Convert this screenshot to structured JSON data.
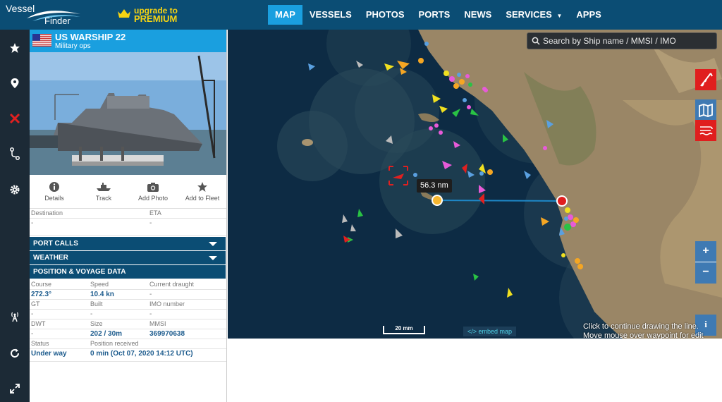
{
  "header": {
    "logo_top": "Vessel",
    "logo_bottom": "Finder",
    "upgrade_line1": "upgrade to",
    "upgrade_line2": "PREMIUM"
  },
  "nav": [
    "MAP",
    "VESSELS",
    "PHOTOS",
    "PORTS",
    "NEWS",
    "SERVICES",
    "APPS"
  ],
  "nav_active": "MAP",
  "sidebar_icons": [
    "star-icon",
    "location-pin-icon",
    "ship-fleet-icon",
    "route-icon",
    "gear-icon",
    "antenna-icon",
    "refresh-icon",
    "expand-icon"
  ],
  "vessel": {
    "name": "US WARSHIP 22",
    "type": "Military ops",
    "flag": "united-states-flag-icon"
  },
  "actions": [
    {
      "label": "Details",
      "icon": "info-icon"
    },
    {
      "label": "Track",
      "icon": "ship-track-icon"
    },
    {
      "label": "Add Photo",
      "icon": "camera-icon"
    },
    {
      "label": "Add to Fleet",
      "icon": "star-icon"
    }
  ],
  "voyage": {
    "destination_label": "Destination",
    "destination_value": "-",
    "eta_label": "ETA",
    "eta_value": "-"
  },
  "sections": {
    "port_calls": "PORT CALLS",
    "weather": "WEATHER",
    "position": "POSITION & VOYAGE DATA"
  },
  "position": {
    "course_label": "Course",
    "course_value": "272.3°",
    "speed_label": "Speed",
    "speed_value": "10.4 kn",
    "draught_label": "Current draught",
    "draught_value": "-",
    "gt_label": "GT",
    "gt_value": "-",
    "built_label": "Built",
    "built_value": "-",
    "imo_label": "IMO number",
    "imo_value": "-",
    "dwt_label": "DWT",
    "dwt_value": "-",
    "size_label": "Size",
    "size_value": "202 / 30m",
    "mmsi_label": "MMSI",
    "mmsi_value": "369970638",
    "status_label": "Status",
    "status_value": "Under way",
    "received_label": "Position received",
    "received_value": "0 min (Oct 07, 2020 14:12 UTC)"
  },
  "map": {
    "search_placeholder": "Search by Ship name / MMSI / IMO",
    "distance_label": "56.3 nm",
    "scale_label": "20 mm",
    "embed_label": "</> embed map",
    "hint_line1": "Click to continue drawing the line.",
    "hint_line2": "Move mouse over waypoint for edit",
    "zoom_in": "+",
    "zoom_out": "−",
    "info": "i",
    "colors": {
      "ocean": "#0d2b44",
      "land": "#9a8666",
      "accent": "#1a9fdf",
      "brand": "#0b4d74",
      "measure_line": "#1e88c8",
      "start_marker": "#f7b731",
      "end_marker": "#e01e1e"
    }
  }
}
